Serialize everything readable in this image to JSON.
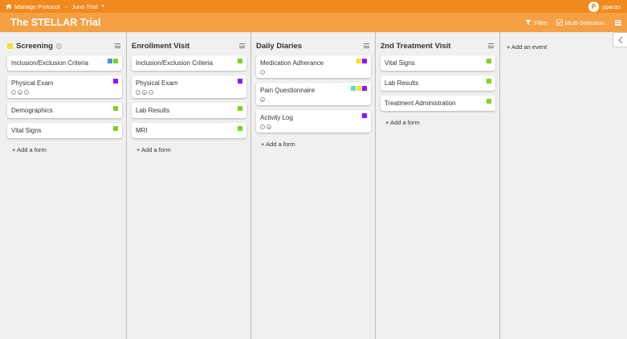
{
  "breadcrumb": {
    "items": [
      "Manage Protocol",
      "Juno Trial"
    ]
  },
  "user": {
    "initial": "P",
    "name": "pparas"
  },
  "header": {
    "title": "The STELLAR Trial",
    "filter_label": "Filter",
    "multi_label": "Multi-Selection"
  },
  "colors": {
    "topbar": "#f08a1e",
    "titlebar": "#f5a043",
    "yellow": "#f3e12d",
    "green": "#7ed321",
    "blue": "#4a90e2",
    "purple": "#9013fe",
    "teal": "#50e3c2"
  },
  "columns": [
    {
      "title": "Screening",
      "add_label": "+ Add a form",
      "cards": [
        {
          "title": "Inclusion/Exclusion Criteria",
          "tags": [
            "#4a90e2",
            "#7ed321"
          ],
          "icons": []
        },
        {
          "title": "Physical Exam",
          "tags": [
            "#9013fe"
          ],
          "icons": [
            "check",
            "person",
            "plus"
          ]
        },
        {
          "title": "Demographics",
          "tags": [
            "#7ed321"
          ],
          "icons": []
        },
        {
          "title": "Vital Signs",
          "tags": [
            "#7ed321"
          ],
          "icons": []
        }
      ]
    },
    {
      "title": "Enrollment Visit",
      "add_label": "+ Add a form",
      "cards": [
        {
          "title": "Inclusion/Exclusion Criteria",
          "tags": [
            "#7ed321"
          ],
          "icons": []
        },
        {
          "title": "Physical Exam",
          "tags": [
            "#9013fe"
          ],
          "icons": [
            "check",
            "person",
            "plus"
          ]
        },
        {
          "title": "Lab Results",
          "tags": [
            "#7ed321"
          ],
          "icons": []
        },
        {
          "title": "MRI",
          "tags": [
            "#7ed321"
          ],
          "icons": []
        }
      ]
    },
    {
      "title": "Daily Diaries",
      "add_label": "+ Add a form",
      "cards": [
        {
          "title": "Medication Adherance",
          "tags": [
            "#f3e12d",
            "#9013fe"
          ],
          "icons": [
            "plus"
          ]
        },
        {
          "title": "Pain Questionnaire",
          "tags": [
            "#50e3c2",
            "#f3e12d",
            "#9013fe"
          ],
          "icons": [
            "person"
          ]
        },
        {
          "title": "Activity Log",
          "tags": [
            "#9013fe"
          ],
          "icons": [
            "check",
            "person"
          ]
        }
      ]
    },
    {
      "title": "2nd Treatment Visit",
      "add_label": "+ Add a form",
      "cards": [
        {
          "title": "Vital Signs",
          "tags": [
            "#7ed321"
          ],
          "icons": []
        },
        {
          "title": "Lab Results",
          "tags": [
            "#7ed321"
          ],
          "icons": []
        },
        {
          "title": "Treatment Administration",
          "tags": [
            "#7ed321"
          ],
          "icons": []
        }
      ]
    }
  ],
  "add_event_label": "+ Add an event"
}
